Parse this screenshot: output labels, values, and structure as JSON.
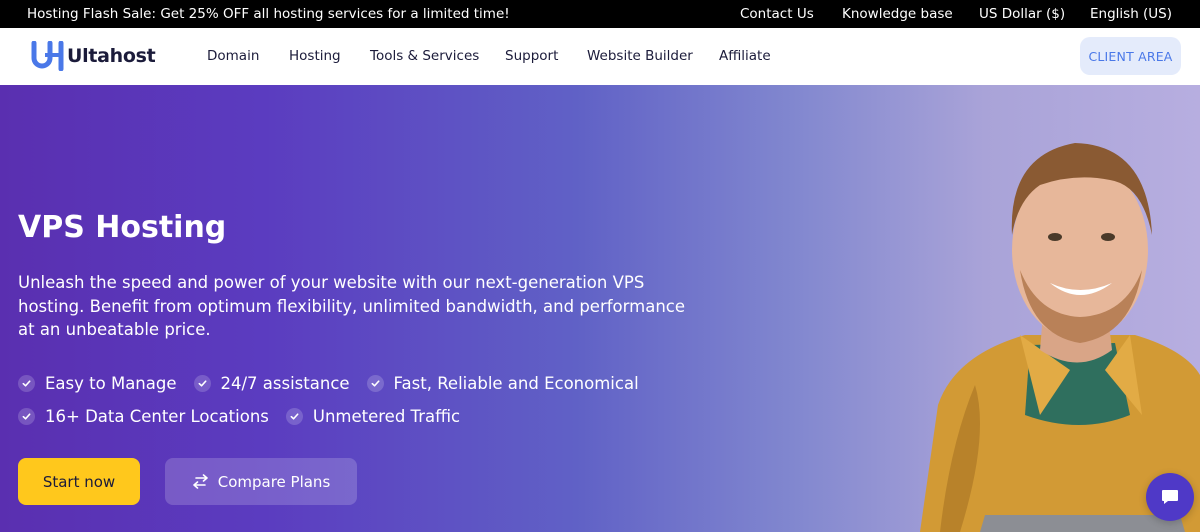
{
  "topbar": {
    "promo": "Hosting Flash Sale: Get 25% OFF all hosting services for a limited time!",
    "links": [
      "Contact Us",
      "Knowledge base",
      "US Dollar ($)",
      "English (US)"
    ]
  },
  "nav": {
    "logo_text": "Ultahost",
    "items": [
      "Domain",
      "Hosting",
      "Tools & Services",
      "Support",
      "Website Builder",
      "Affiliate"
    ],
    "client_area": "CLIENT AREA"
  },
  "hero": {
    "title": "VPS Hosting",
    "description": "Unleash the speed and power of your website with our next-generation VPS hosting. Benefit from optimum flexibility, unlimited bandwidth, and performance at an unbeatable price.",
    "features_row1": [
      "Easy to Manage",
      "24/7 assistance",
      "Fast, Reliable and Economical"
    ],
    "features_row2": [
      "16+ Data Center Locations",
      "Unmetered Traffic"
    ],
    "start_button": "Start now",
    "compare_button": "Compare Plans"
  },
  "colors": {
    "accent_yellow": "#ffc81c",
    "brand_blue": "#4a78e8",
    "hero_purple": "#5a2fb0",
    "chat_purple": "#4f39c7"
  },
  "icons": [
    "check-icon",
    "swap-arrows-icon",
    "chat-icon"
  ]
}
